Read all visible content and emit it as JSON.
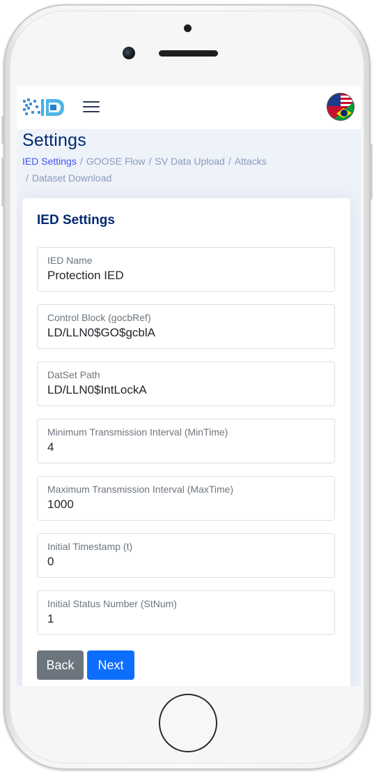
{
  "page": {
    "title": "Settings"
  },
  "breadcrumb": {
    "items": [
      "IED Settings",
      "GOOSE Flow",
      "SV Data Upload",
      "Attacks",
      "Dataset Download"
    ],
    "separator": "/"
  },
  "card": {
    "title": "IED Settings",
    "fields": [
      {
        "label": "IED Name",
        "value": "Protection IED"
      },
      {
        "label": "Control Block (gocbRef)",
        "value": "LD/LLN0$GO$gcblA"
      },
      {
        "label": "DatSet Path",
        "value": "LD/LLN0$IntLockA"
      },
      {
        "label": "Minimum Transmission Interval (MinTime)",
        "value": "4"
      },
      {
        "label": "Maximum Transmission Interval (MaxTime)",
        "value": "1000"
      },
      {
        "label": "Initial Timestamp (t)",
        "value": "0"
      },
      {
        "label": "Initial Status Number (StNum)",
        "value": "1"
      }
    ],
    "buttons": {
      "back": "Back",
      "next": "Next"
    }
  },
  "icons": {
    "logo": "logo-icon",
    "menu": "hamburger-menu-icon",
    "language": "language-flag-icon"
  },
  "colors": {
    "primary": "#4154f1",
    "title": "#012970",
    "back_button": "#6c757d",
    "next_button": "#0d6efd",
    "screen_background": "#eef2f9"
  }
}
